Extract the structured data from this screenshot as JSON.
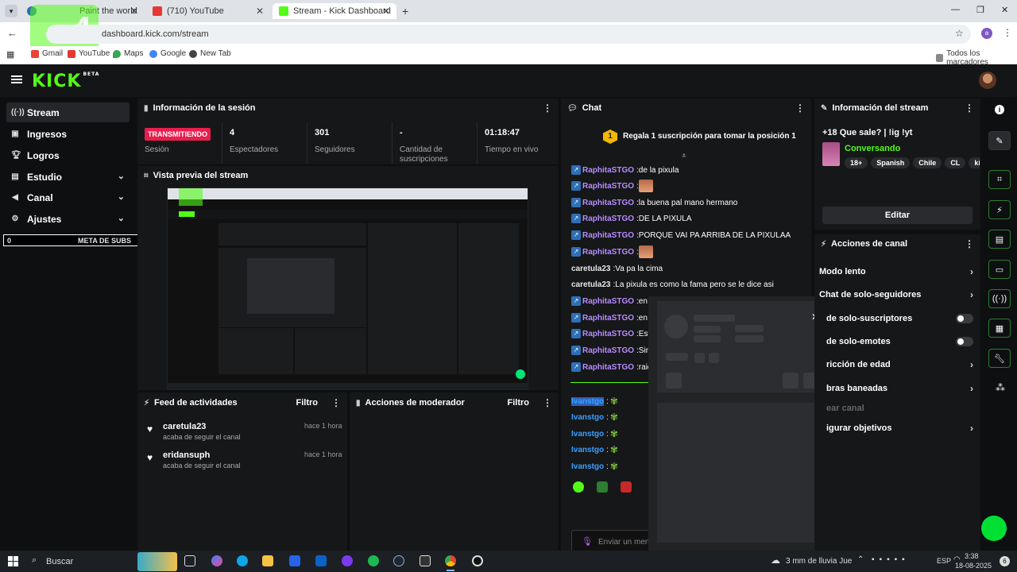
{
  "browser": {
    "tabs": [
      {
        "title": "Paint the world",
        "color": "#2b6cb0"
      },
      {
        "title": "(710) YouTube",
        "color": "#e53935"
      },
      {
        "title": "Stream - Kick Dashboard",
        "color": "#53fc18"
      }
    ],
    "new_tab_symbol": "+",
    "url": "dashboard.kick.com/stream",
    "profile_letter": "a",
    "bookmarks": [
      "Gmail",
      "YouTube",
      "Maps",
      "Google",
      "New Tab"
    ],
    "all_bookmarks": "Todos los marcadores",
    "overlay_text": "4"
  },
  "app": {
    "logo": "KICK",
    "logo_sup": "BETA",
    "brand_color": "#53fc18"
  },
  "nav": [
    {
      "label": "Stream",
      "icon": "stream-icon",
      "active": true
    },
    {
      "label": "Ingresos",
      "icon": "revenue-icon"
    },
    {
      "label": "Logros",
      "icon": "trophy-icon"
    },
    {
      "label": "Estudio",
      "icon": "studio-icon"
    },
    {
      "label": "Canal",
      "icon": "channel-icon"
    },
    {
      "label": "Ajustes",
      "icon": "gear-icon"
    }
  ],
  "sub_goal": {
    "current": "0",
    "label": "META DE SUBS",
    "target": "6"
  },
  "session": {
    "title": "Información de la sesión",
    "live_badge": "TRANSMITIENDO",
    "session_label": "Sesión",
    "stats": [
      {
        "value": "4",
        "label": "Espectadores"
      },
      {
        "value": "301",
        "label": "Seguidores"
      },
      {
        "value": "-",
        "label": "Cantidad de suscripciones"
      },
      {
        "value": "01:18:47",
        "label": "Tiempo en vivo"
      }
    ]
  },
  "preview": {
    "title": "Vista previa del stream"
  },
  "activity": {
    "title": "Feed de actividades",
    "filter": "Filtro",
    "items": [
      {
        "name": "caretula23",
        "desc": "acaba de seguir el canal",
        "time": "hace 1 hora"
      },
      {
        "name": "eridansuph",
        "desc": "acaba de seguir el canal",
        "time": "hace 1 hora"
      }
    ]
  },
  "mod_actions": {
    "title": "Acciones de moderador",
    "filter": "Filtro"
  },
  "chat": {
    "title": "Chat",
    "gift_rank": "1",
    "gift_text": "Regala 1 suscripción para tomar la posición 1",
    "messages": [
      {
        "user": "RaphitaSTGO",
        "text": "de la pixula"
      },
      {
        "user": "RaphitaSTGO",
        "text": ""
      },
      {
        "user": "RaphitaSTGO",
        "text": "la buena pal mano hermano"
      },
      {
        "user": "RaphitaSTGO",
        "text": "DE LA PIXULA"
      },
      {
        "user": "RaphitaSTGO",
        "text": "PORQUE VAI PA ARRIBA DE LA PIXULAA"
      },
      {
        "user": "RaphitaSTGO",
        "text": ""
      },
      {
        "user": "caretula23",
        "text": "Va pa la cima"
      },
      {
        "user": "caretula23",
        "text": "La pixula es como la fama pero se le dice asi"
      },
      {
        "user": "RaphitaSTGO",
        "text": "en ot"
      },
      {
        "user": "RaphitaSTGO",
        "text": "en nu"
      },
      {
        "user": "RaphitaSTGO",
        "text": "Esta"
      },
      {
        "user": "RaphitaSTGO",
        "text": "Since"
      },
      {
        "user": "RaphitaSTGO",
        "text": "raide"
      }
    ],
    "viewer_messages": [
      {
        "user": "Ivanstgo"
      },
      {
        "user": "Ivanstgo"
      },
      {
        "user": "Ivanstgo"
      },
      {
        "user": "Ivanstgo"
      },
      {
        "user": "Ivanstgo"
      }
    ],
    "input_placeholder": "Enviar un men"
  },
  "stream_info": {
    "title": "Información del stream",
    "stream_title": "+18 Que sale? | !ig !yt",
    "category": "Conversando",
    "tags": [
      "18+",
      "Spanish",
      "Chile",
      "CL",
      "kick"
    ],
    "edit": "Editar"
  },
  "channel_actions": {
    "title": "Acciones de canal",
    "rows": [
      {
        "label": "Modo lento",
        "control": "chevron"
      },
      {
        "label": "Chat de solo-seguidores",
        "control": "chevron"
      },
      {
        "label": "de solo-suscriptores",
        "control": "toggle"
      },
      {
        "label": "de solo-emotes",
        "control": "toggle"
      },
      {
        "label": "ricción de edad",
        "control": "chevron"
      },
      {
        "label": "bras baneadas",
        "control": "chevron"
      },
      {
        "label": "ear canal",
        "control": "none"
      },
      {
        "label": "igurar objetivos",
        "control": "chevron"
      }
    ]
  },
  "taskbar": {
    "search": "Buscar",
    "weather": "3 mm de lluvia Jue",
    "lang": "ESP",
    "time": "3:38",
    "date": "18-08-2025"
  }
}
